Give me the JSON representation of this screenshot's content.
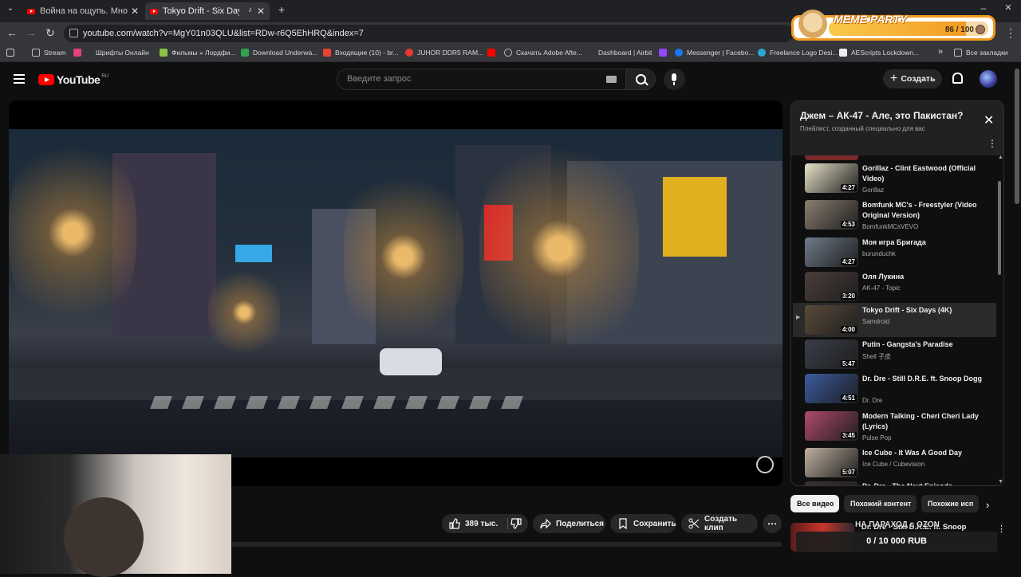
{
  "browser": {
    "tabs": [
      {
        "title": "Война на ощупь. Много всего",
        "active": false
      },
      {
        "title": "Tokyo Drift - Six Days (4K)",
        "active": true
      }
    ],
    "new_tab": "+",
    "url": "youtube.com/watch?v=MgY01n03QLU&list=RDw-r6Q5EhHRQ&index=7",
    "bookmarks": [
      "Stream",
      "Шрифты Онлайн",
      "Фильмы » Лордфи...",
      "Download Underwa...",
      "Входящие (10) - br...",
      "JUHOR DDR5 RAM...",
      "Скачать Adobe Afte...",
      "Dashboard | Airbit",
      "Messenger | Facebo...",
      "Freelance Logo Desi...",
      "AEScripts Lockdown...",
      "»",
      "Все закладки"
    ]
  },
  "meme_widget": {
    "label": "MEME PARTY",
    "count": "86 / 100",
    "progress": 0.86
  },
  "youtube": {
    "logo": "YouTube",
    "region": "RU",
    "search_placeholder": "Введите запрос",
    "create_label": "Создать"
  },
  "actions": {
    "likes": "389 тыс.",
    "share": "Поделиться",
    "save": "Сохранить",
    "clip": "Создать клип",
    "more": "⋯"
  },
  "playlist": {
    "title": "Джем – АК-47 - Але, это Пакистан?",
    "subtitle": "Плейлист, созданный специально для вас",
    "items": [
      {
        "title": "Gorillaz - Clint Eastwood (Official Video)",
        "channel": "Gorillaz",
        "duration": "4:27",
        "active": false,
        "color": "#e8e2c8"
      },
      {
        "title": "Bomfunk MC's - Freestyler (Video Original Version)",
        "channel": "BomfunkMCsVEVO",
        "duration": "4:53",
        "active": false,
        "color": "#8a7e70"
      },
      {
        "title": "Моя игра Бригада",
        "channel": "burunduchk",
        "duration": "4:27",
        "active": false,
        "color": "#6f7a8a"
      },
      {
        "title": "Оля Лукина",
        "channel": "AK-47 - Topic",
        "duration": "3:20",
        "active": false,
        "color": "#4a3e3a"
      },
      {
        "title": "Tokyo Drift - Six Days (4K)",
        "channel": "Samdroid",
        "duration": "4:00",
        "active": true,
        "color": "#5a4a3a"
      },
      {
        "title": "Putin - Gangsta's Paradise",
        "channel": "Shell 子皮",
        "duration": "5:47",
        "active": false,
        "color": "#3a3e4a"
      },
      {
        "title": "Dr. Dre - Still D.R.E. ft. Snoop Dogg",
        "channel": "Dr. Dre",
        "duration": "4:51",
        "active": false,
        "color": "#3a5aa0"
      },
      {
        "title": "Modern Talking - Cheri Cheri Lady (Lyrics)",
        "channel": "Pulse Pop",
        "duration": "3:45",
        "active": false,
        "color": "#b04a6a"
      },
      {
        "title": "Ice Cube - It Was A Good Day",
        "channel": "Ice Cube / Cubevision",
        "duration": "5:07",
        "active": false,
        "color": "#c0b0a0"
      },
      {
        "title": "Dr. Dre - The Next Episode",
        "channel": "",
        "duration": "",
        "active": false,
        "color": "#3a3030"
      }
    ],
    "active_marker": "▶"
  },
  "chips": [
    "Все видео",
    "Похожий контент",
    "Похожие исп"
  ],
  "suggestion": {
    "title": "Dr. Dre - Still D.R.E. ft. Snoop"
  },
  "ozon": {
    "title": "НА ПАРАХОД с OZON",
    "amount": "0 / 10 000 RUB"
  }
}
